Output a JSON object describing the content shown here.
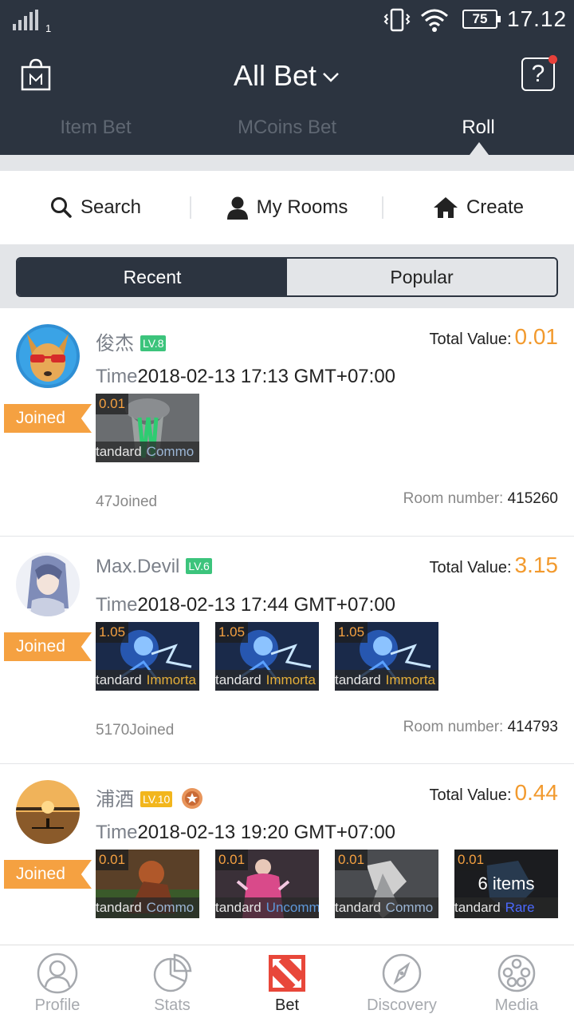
{
  "status_bar": {
    "sim_slot": "1",
    "battery": "75",
    "clock": "17.12"
  },
  "header": {
    "title": "All Bet"
  },
  "tabs": [
    {
      "label": "Item Bet",
      "active": false
    },
    {
      "label": "MCoins Bet",
      "active": false
    },
    {
      "label": "Roll",
      "active": true
    }
  ],
  "actions": {
    "search": "Search",
    "my_rooms": "My Rooms",
    "create": "Create"
  },
  "segment": {
    "recent": "Recent",
    "popular": "Popular",
    "selected": "Recent"
  },
  "labels": {
    "total_value": "Total Value:",
    "time": "Time",
    "joined": "Joined",
    "room_number": "Room number:"
  },
  "colors": {
    "header_bg": "#2c3440",
    "accent_orange": "#f5a141",
    "value_orange": "#f29a2e",
    "level_green": "#3cc47c",
    "level_yellow": "#f2b61d"
  },
  "rooms": [
    {
      "username": "俊杰",
      "level": "LV.8",
      "level_color": "#3cc47c",
      "total_value": "0.01",
      "time": "2018-02-13 17:13 GMT+07:00",
      "joined_status": "Joined",
      "joined_count": "47Joined",
      "room_number": "415260",
      "items": [
        {
          "price": "0.01",
          "quality": "tandard",
          "rarity": "Commo",
          "rarity_color": "#9bb5d4"
        }
      ]
    },
    {
      "username": "Max.Devil",
      "level": "LV.6",
      "level_color": "#3cc47c",
      "total_value": "3.15",
      "time": "2018-02-13 17:44 GMT+07:00",
      "joined_status": "Joined",
      "joined_count": "5170Joined",
      "room_number": "414793",
      "items": [
        {
          "price": "1.05",
          "quality": "tandard",
          "rarity": "Immorta",
          "rarity_color": "#e4ae39"
        },
        {
          "price": "1.05",
          "quality": "tandard",
          "rarity": "Immorta",
          "rarity_color": "#e4ae39"
        },
        {
          "price": "1.05",
          "quality": "tandard",
          "rarity": "Immorta",
          "rarity_color": "#e4ae39"
        }
      ]
    },
    {
      "username": "浦酒",
      "level": "LV.10",
      "level_color": "#f2b61d",
      "medal": true,
      "total_value": "0.44",
      "time": "2018-02-13 19:20 GMT+07:00",
      "joined_status": "Joined",
      "items": [
        {
          "price": "0.01",
          "quality": "tandard",
          "rarity": "Commo",
          "rarity_color": "#9bb5d4"
        },
        {
          "price": "0.01",
          "quality": "tandard",
          "rarity": "Uncomm",
          "rarity_color": "#5e98d9"
        },
        {
          "price": "0.01",
          "quality": "tandard",
          "rarity": "Commo",
          "rarity_color": "#9bb5d4"
        },
        {
          "price": "0.01",
          "quality": "tandard",
          "rarity": "Rare",
          "rarity_color": "#4b69ff",
          "more": "6 items"
        }
      ]
    }
  ],
  "bottom_nav": [
    {
      "label": "Profile",
      "icon": "profile-icon",
      "active": false
    },
    {
      "label": "Stats",
      "icon": "stats-icon",
      "active": false
    },
    {
      "label": "Bet",
      "icon": "dota-icon",
      "active": true
    },
    {
      "label": "Discovery",
      "icon": "compass-icon",
      "active": false
    },
    {
      "label": "Media",
      "icon": "film-reel-icon",
      "active": false
    }
  ]
}
